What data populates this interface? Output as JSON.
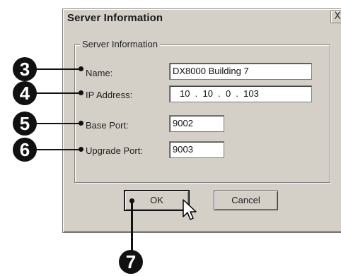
{
  "dialog": {
    "title": "Server Information",
    "close_label": "X",
    "group_label": "Server Information"
  },
  "fields": {
    "name": {
      "label": "Name:",
      "value": "DX8000 Building 7"
    },
    "ip": {
      "label": "IP Address:",
      "octets": [
        "10",
        "10",
        "0",
        "103"
      ],
      "separator": "."
    },
    "base_port": {
      "label": "Base Port:",
      "value": "9002"
    },
    "upgrade_port": {
      "label": "Upgrade Port:",
      "value": "9003"
    }
  },
  "buttons": {
    "ok": "OK",
    "cancel": "Cancel"
  },
  "callouts": {
    "name": "3",
    "ip": "4",
    "base_port": "5",
    "upgrade_port": "6",
    "ok": "7"
  },
  "colors": {
    "dialog_bg": "#d4d0c8",
    "callout": "#111111"
  }
}
